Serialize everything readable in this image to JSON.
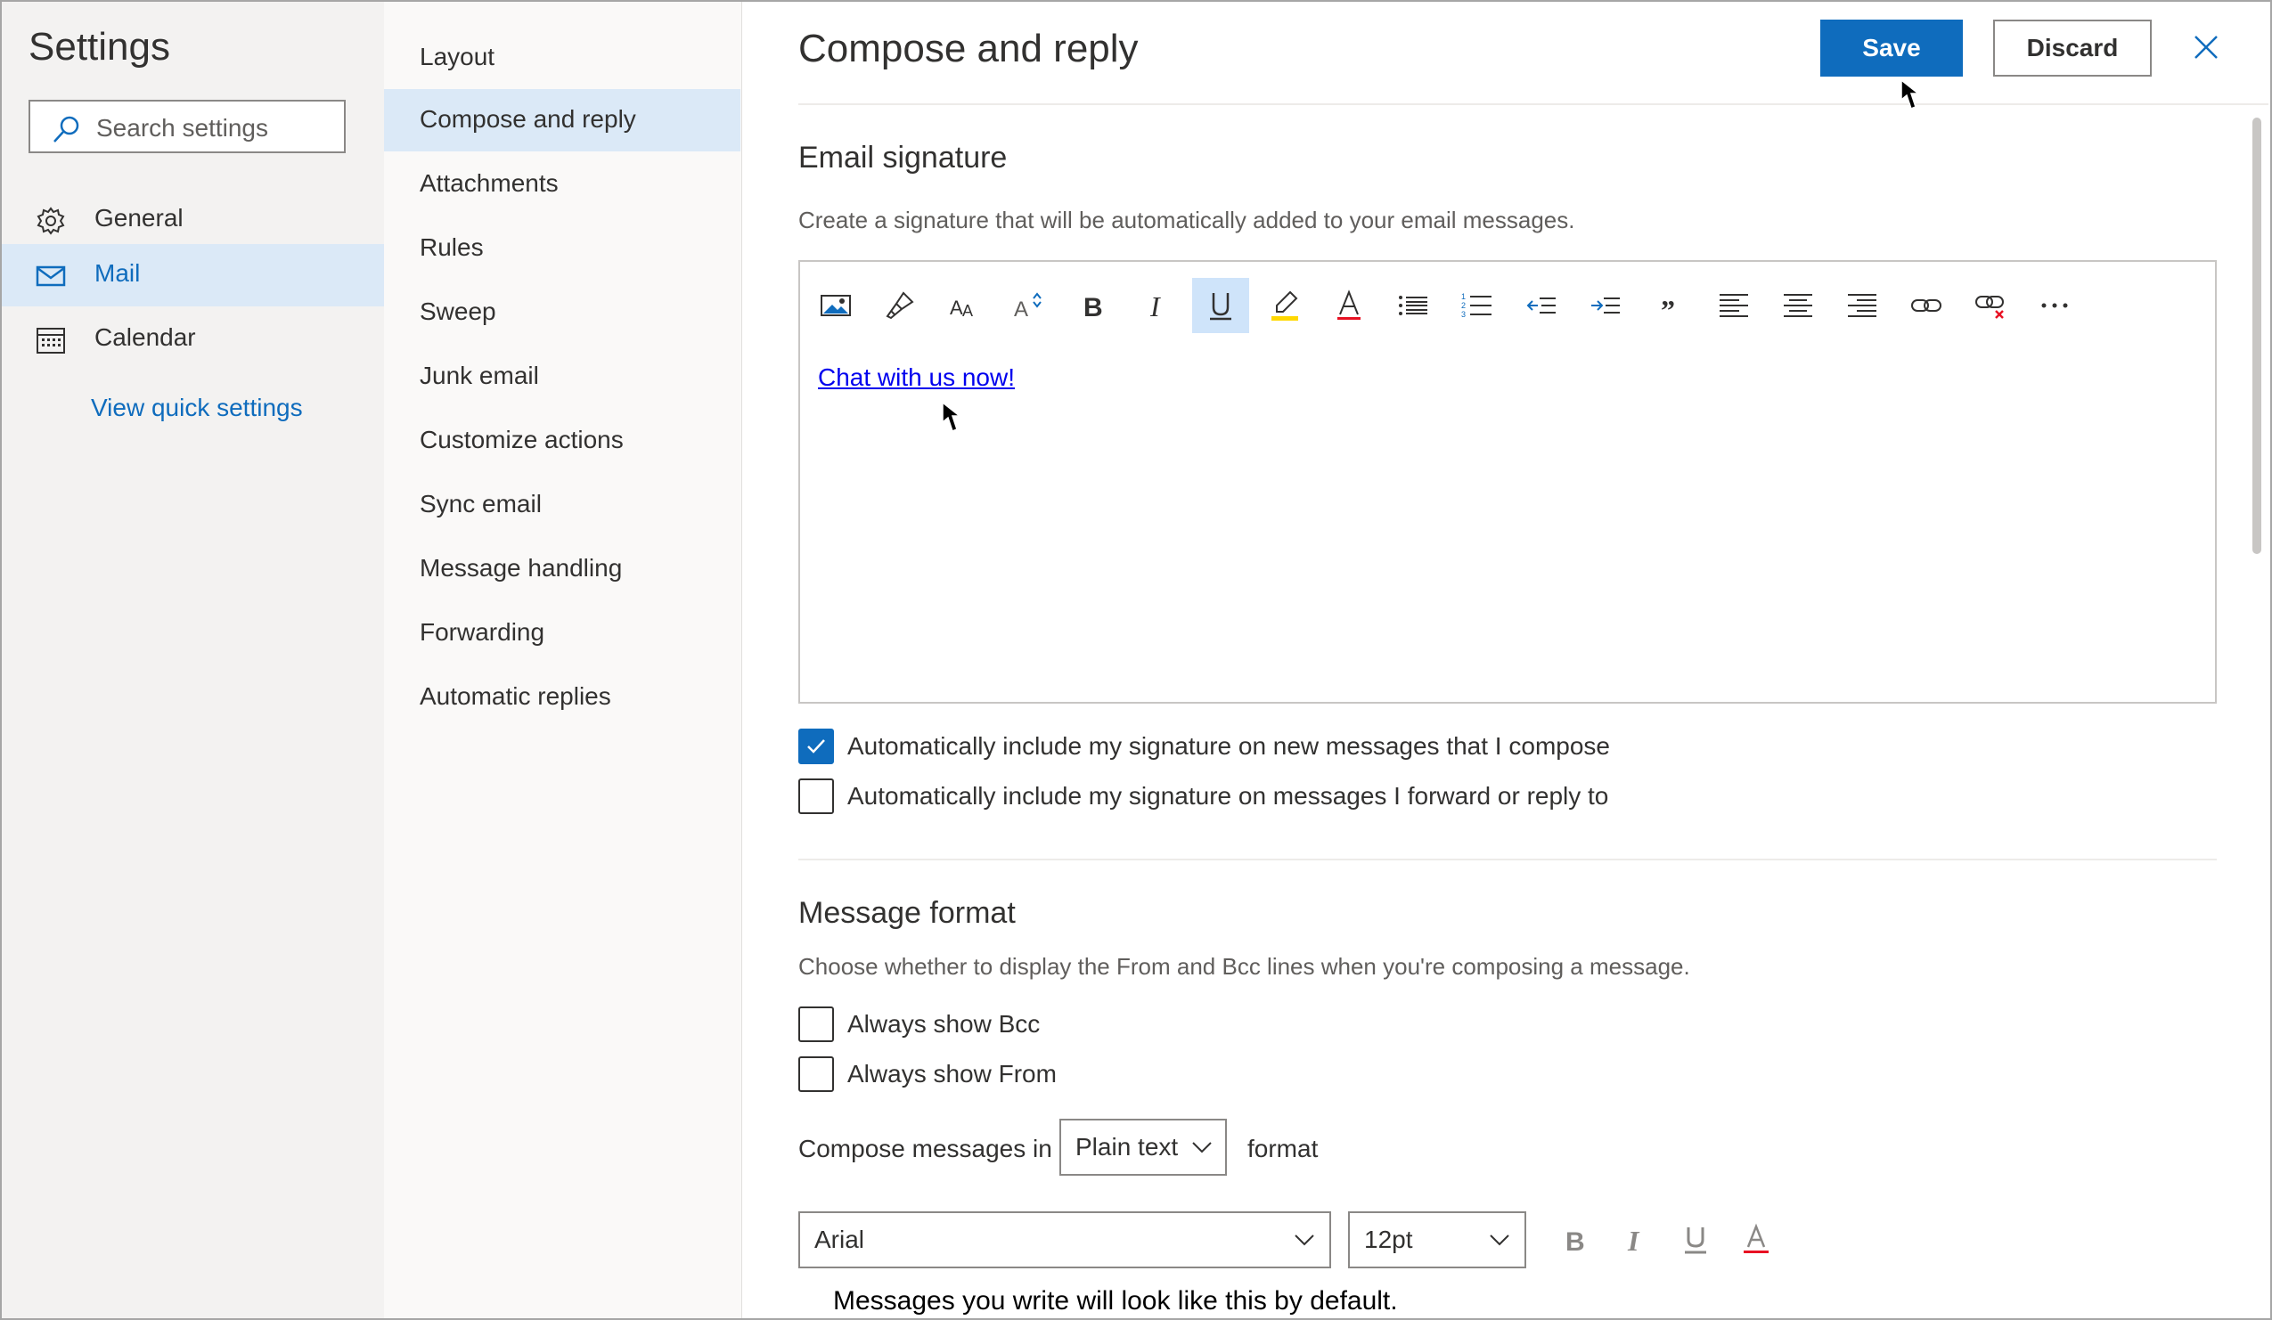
{
  "sidebar": {
    "title": "Settings",
    "search_placeholder": "Search settings",
    "items": [
      {
        "label": "General",
        "icon": "gear-icon",
        "selected": false
      },
      {
        "label": "Mail",
        "icon": "mail-icon",
        "selected": true
      },
      {
        "label": "Calendar",
        "icon": "calendar-icon",
        "selected": false
      }
    ],
    "quick_settings_link": "View quick settings"
  },
  "subnav": {
    "items": [
      {
        "label": "Layout",
        "selected": false
      },
      {
        "label": "Compose and reply",
        "selected": true
      },
      {
        "label": "Attachments",
        "selected": false
      },
      {
        "label": "Rules",
        "selected": false
      },
      {
        "label": "Sweep",
        "selected": false
      },
      {
        "label": "Junk email",
        "selected": false
      },
      {
        "label": "Customize actions",
        "selected": false
      },
      {
        "label": "Sync email",
        "selected": false
      },
      {
        "label": "Message handling",
        "selected": false
      },
      {
        "label": "Forwarding",
        "selected": false
      },
      {
        "label": "Automatic replies",
        "selected": false
      }
    ]
  },
  "header": {
    "title": "Compose and reply",
    "save_label": "Save",
    "discard_label": "Discard",
    "close_icon": "close-icon"
  },
  "signature": {
    "heading": "Email signature",
    "description": "Create a signature that will be automatically added to your email messages.",
    "toolbar": [
      "insert-picture-icon",
      "format-painter-icon",
      "font-icon",
      "font-size-icon",
      "bold-icon",
      "italic-icon",
      "underline-icon",
      "highlight-icon",
      "font-color-icon",
      "bullets-icon",
      "numbering-icon",
      "decrease-indent-icon",
      "increase-indent-icon",
      "quote-icon",
      "align-left-icon",
      "align-center-icon",
      "align-right-icon",
      "insert-link-icon",
      "remove-link-icon",
      "more-options-icon"
    ],
    "active_tool": "underline-icon",
    "content_link": "Chat with us now!",
    "options": [
      {
        "label": "Automatically include my signature on new messages that I compose",
        "checked": true
      },
      {
        "label": "Automatically include my signature on messages I forward or reply to",
        "checked": false
      }
    ]
  },
  "message_format": {
    "heading": "Message format",
    "description": "Choose whether to display the From and Bcc lines when you're composing a message.",
    "options": [
      {
        "label": "Always show Bcc",
        "checked": false
      },
      {
        "label": "Always show From",
        "checked": false
      }
    ],
    "compose_prefix": "Compose messages in",
    "compose_format": "Plain text",
    "compose_suffix": "format",
    "font": "Arial",
    "size": "12pt",
    "preview_text": "Messages you write will look like this by default."
  },
  "colors": {
    "accent": "#0f6cbd",
    "selected_bg": "#dbe9f7",
    "font_color_underline": "#e81123",
    "highlight": "#ffd800"
  }
}
